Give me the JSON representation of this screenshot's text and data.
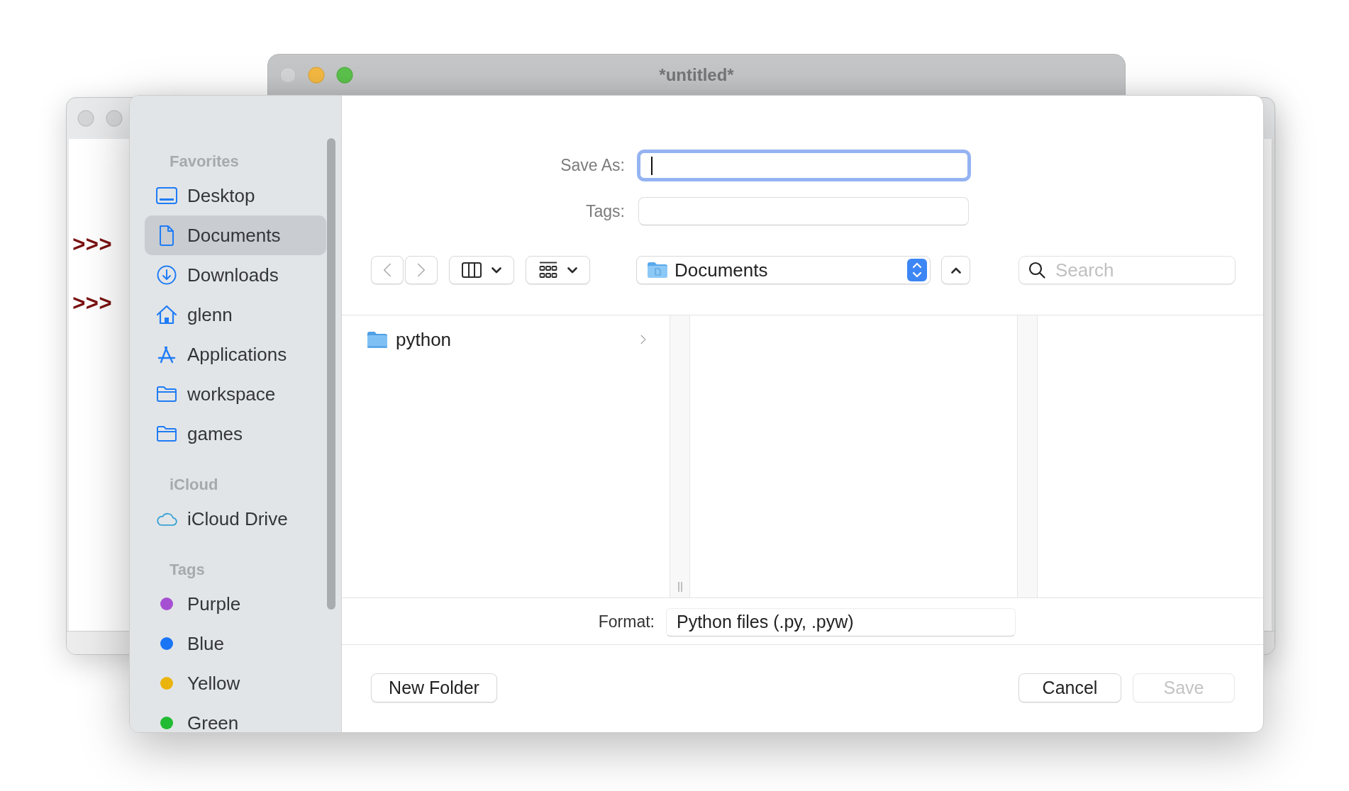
{
  "background_window": {
    "title": "*untitled*",
    "controls": [
      {
        "enabled": false
      },
      {
        "enabled": true
      },
      {
        "enabled": true
      }
    ]
  },
  "shell_window": {
    "controls": [
      {
        "enabled": false
      },
      {
        "enabled": false
      }
    ],
    "prompts": [
      ">>>",
      ">>>"
    ]
  },
  "dialog": {
    "sidebar": {
      "sections": [
        {
          "title": "Favorites",
          "items": [
            {
              "label": "Desktop",
              "kind": "desktop",
              "selected": false
            },
            {
              "label": "Documents",
              "kind": "document",
              "selected": true
            },
            {
              "label": "Downloads",
              "kind": "download",
              "selected": false
            },
            {
              "label": "glenn",
              "kind": "home",
              "selected": false
            },
            {
              "label": "Applications",
              "kind": "apps",
              "selected": false
            },
            {
              "label": "workspace",
              "kind": "folder",
              "selected": false
            },
            {
              "label": "games",
              "kind": "folder",
              "selected": false
            }
          ]
        },
        {
          "title": "iCloud",
          "items": [
            {
              "label": "iCloud Drive",
              "kind": "cloud",
              "selected": false
            }
          ]
        },
        {
          "title": "Tags",
          "items": [
            {
              "label": "Purple",
              "kind": "tag",
              "color": "#a550d2",
              "selected": false
            },
            {
              "label": "Blue",
              "kind": "tag",
              "color": "#1a75f5",
              "selected": false
            },
            {
              "label": "Yellow",
              "kind": "tag",
              "color": "#ebb40c",
              "selected": false
            },
            {
              "label": "Green",
              "kind": "tag",
              "color": "#21bb33",
              "selected": false
            }
          ]
        }
      ]
    },
    "save_as": {
      "label": "Save As:",
      "focused": true
    },
    "tags": {
      "label": "Tags:"
    },
    "toolbar": {
      "back": {
        "disabled": true
      },
      "forward": {
        "disabled": true
      },
      "location": "Documents",
      "search": {
        "placeholder": "Search"
      }
    },
    "browser": {
      "columns": [
        {
          "entries": [
            {
              "name": "python",
              "kind": "folder",
              "selected": false
            }
          ]
        }
      ]
    },
    "format": {
      "label": "Format:",
      "value": "Python files (.py, .pyw)"
    },
    "buttons": [
      {
        "label": "New Folder",
        "kind": "new_folder",
        "disabled": false
      },
      {
        "label": "Cancel",
        "kind": "cancel",
        "disabled": false
      },
      {
        "label": "Save",
        "kind": "save",
        "disabled": true
      }
    ]
  }
}
